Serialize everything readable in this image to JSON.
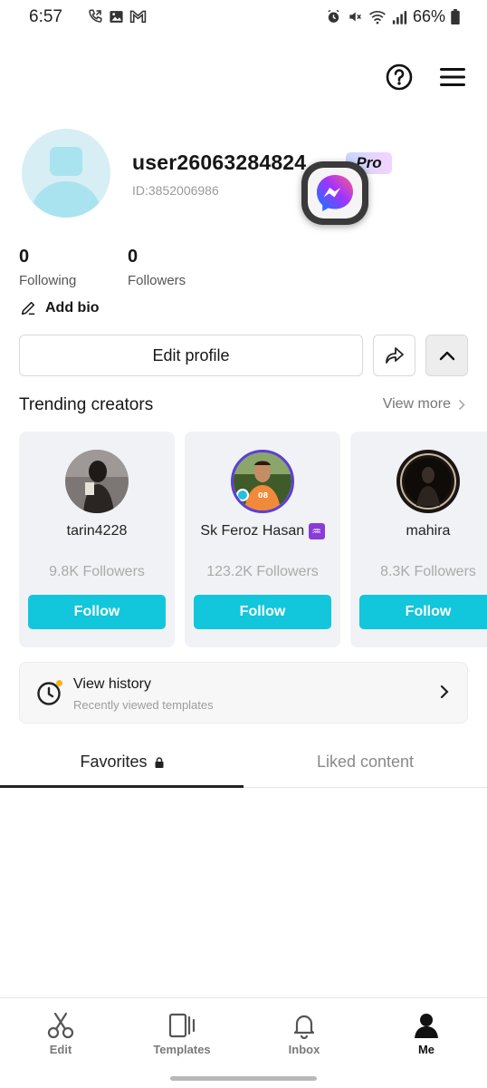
{
  "status_bar": {
    "time": "6:57",
    "battery": "66%"
  },
  "profile": {
    "username": "user26063284824",
    "pro_badge": "Pro",
    "user_id": "ID:3852006986",
    "following_count": "0",
    "following_label": "Following",
    "followers_count": "0",
    "followers_label": "Followers",
    "add_bio": "Add bio",
    "edit_profile": "Edit profile"
  },
  "trending": {
    "title": "Trending creators",
    "view_more": "View more",
    "creators": [
      {
        "name": "tarin4228",
        "followers": "9.8K Followers",
        "follow": "Follow"
      },
      {
        "name": "Sk Feroz Hasan",
        "followers": "123.2K Followers",
        "follow": "Follow"
      },
      {
        "name": "mahira",
        "followers": "8.3K Followers",
        "follow": "Follow"
      }
    ]
  },
  "history": {
    "title": "View history",
    "subtitle": "Recently viewed templates"
  },
  "tabs": {
    "favorites": "Favorites",
    "liked": "Liked content"
  },
  "nav": {
    "edit": "Edit",
    "templates": "Templates",
    "inbox": "Inbox",
    "me": "Me"
  },
  "colors": {
    "accent": "#12c6dc",
    "avatar_bg": "#d6eef4"
  }
}
